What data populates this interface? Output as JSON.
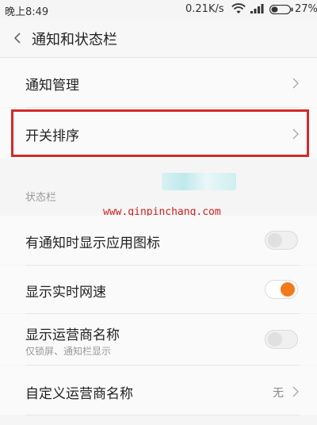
{
  "status_bar": {
    "time": "晚上8:49",
    "net_speed": "0.21K/s",
    "battery_pct": "27%",
    "wifi_icon": "wifi-icon",
    "signal_icon": "signal-icon",
    "battery_icon": "battery-icon"
  },
  "header": {
    "title": "通知和状态栏",
    "back_icon": "chevron-left-icon"
  },
  "items": {
    "notification_management": "通知管理",
    "switch_order": "开关排序"
  },
  "section_status_bar": "状态栏",
  "watermark": "www.qinpinchang.com",
  "toggles": {
    "show_app_icon": {
      "label": "有通知时显示应用图标",
      "on": false
    },
    "show_speed": {
      "label": "显示实时网速",
      "on": true
    },
    "show_carrier": {
      "label": "显示运营商名称",
      "sub": "仅锁屏、通知栏显示",
      "on": false
    }
  },
  "custom_carrier": {
    "label": "自定义运营商名称",
    "value": "无"
  },
  "colors": {
    "accent": "#f27a1a",
    "highlight": "#d12a2a"
  }
}
